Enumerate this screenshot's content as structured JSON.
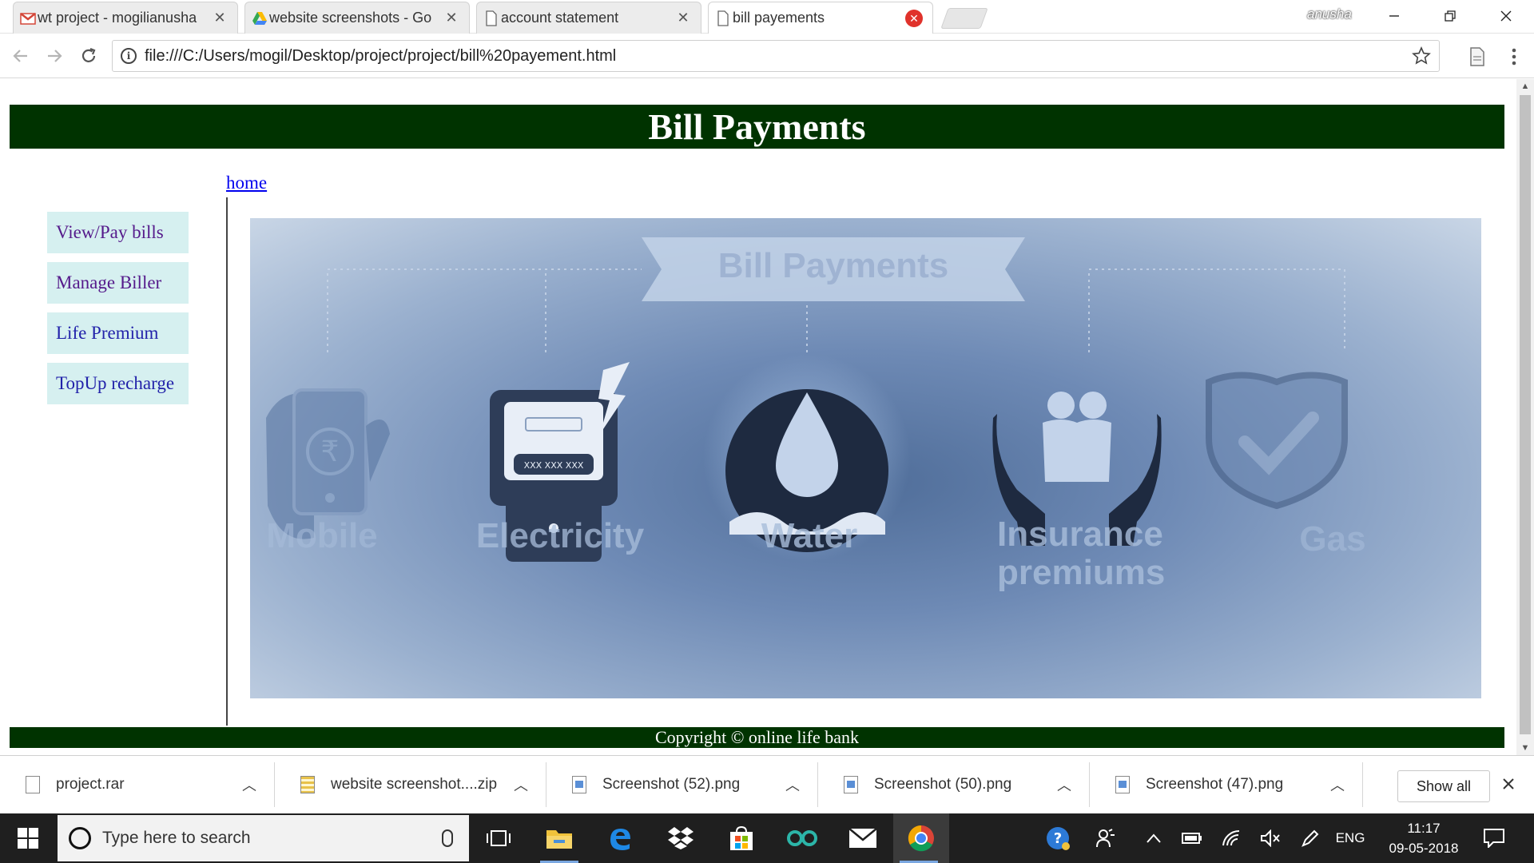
{
  "browser": {
    "tabs": [
      {
        "title": "wt project - mogilianusha",
        "icon": "gmail-icon",
        "active": false
      },
      {
        "title": "website screenshots - Go",
        "icon": "google-drive-icon",
        "active": false
      },
      {
        "title": "account statement",
        "icon": "page-icon",
        "active": false
      },
      {
        "title": "bill payements",
        "icon": "page-icon",
        "active": true
      }
    ],
    "tab_close_glyph": "✕",
    "profile_name": "anusha",
    "url": "file:///C:/Users/mogil/Desktop/project/project/bill%20payement.html"
  },
  "page": {
    "header_title": "Bill Payments",
    "home_link": "home",
    "menu": [
      {
        "label": "View/Pay bills",
        "visited": true
      },
      {
        "label": "Manage Biller",
        "visited": true
      },
      {
        "label": "Life Premium",
        "visited": false
      },
      {
        "label": "TopUp recharge",
        "visited": false
      }
    ],
    "banner": {
      "title": "Bill Payments",
      "categories": [
        {
          "label": "Mobile",
          "icon": "mobile-rupee-icon"
        },
        {
          "label": "Electricity",
          "icon": "electricity-meter-icon",
          "meter_text": "XXX XXX XXX"
        },
        {
          "label": "Water",
          "icon": "water-drop-icon"
        },
        {
          "label": "Insurance premiums",
          "icon": "insurance-family-icon"
        },
        {
          "label": "Gas",
          "icon": "shield-check-icon"
        }
      ]
    },
    "footer": "Copyright © online life bank"
  },
  "downloads": {
    "items": [
      {
        "name": "project.rar",
        "type": "file"
      },
      {
        "name": "website screenshot....zip",
        "type": "zip"
      },
      {
        "name": "Screenshot (52).png",
        "type": "image"
      },
      {
        "name": "Screenshot (50).png",
        "type": "image"
      },
      {
        "name": "Screenshot (47).png",
        "type": "image"
      }
    ],
    "show_all": "Show all"
  },
  "taskbar": {
    "search_placeholder": "Type here to search",
    "language": "ENG",
    "time": "11:17",
    "date": "09-05-2018"
  },
  "colors": {
    "header_bg": "#003300",
    "menu_bg": "#d6f0f0",
    "banner_blue": "#6e8ab5",
    "taskbar_bg": "#1f1f1f"
  }
}
